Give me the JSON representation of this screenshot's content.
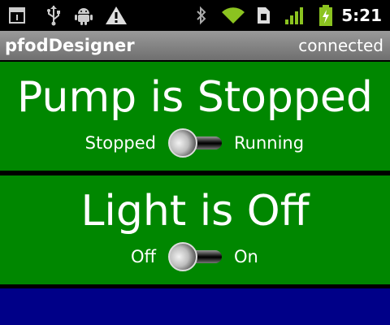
{
  "status_bar": {
    "time": "5:21",
    "icons": [
      "notification-calendar-icon",
      "usb-icon",
      "android-debug-icon",
      "warning-icon",
      "bluetooth-icon",
      "wifi-icon",
      "sim-icon",
      "signal-icon",
      "battery-charging-icon"
    ],
    "colors": {
      "wifi": "#8bc320",
      "signal": "#8bc320",
      "battery": "#8bc320"
    }
  },
  "app_bar": {
    "title": "pfodDesigner",
    "status": "connected"
  },
  "panels": [
    {
      "title": "Pump is Stopped",
      "switch": {
        "off_label": "Stopped",
        "on_label": "Running",
        "state": "off"
      }
    },
    {
      "title": "Light is Off",
      "switch": {
        "off_label": "Off",
        "on_label": "On",
        "state": "off"
      }
    }
  ],
  "colors": {
    "panel_green": "#008700",
    "panel_blue": "#000088",
    "divider": "#ffffff"
  }
}
